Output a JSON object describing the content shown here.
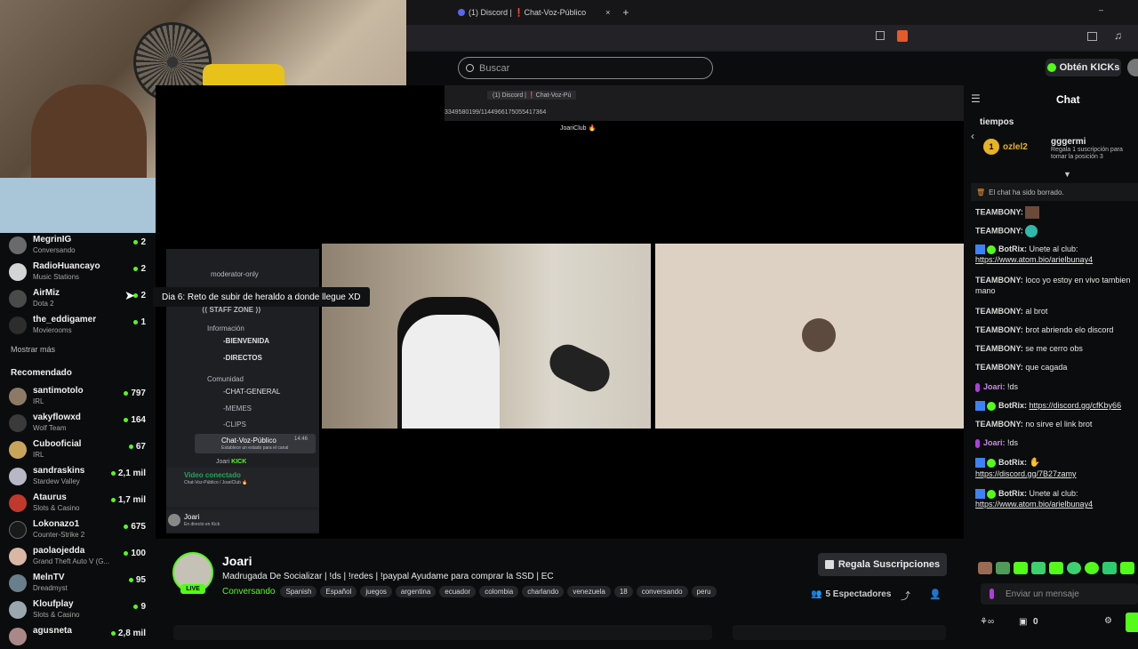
{
  "browser": {
    "tab_title": "(1) Discord | ❗Chat-Voz-Público",
    "new_tab": "+",
    "inner_tab_title": "(1) Discord | ❗Chat-Voz-Pú",
    "inner_url": "3349580199/1144966175055417364",
    "inner_bookmark": "JoariClub 🔥"
  },
  "kick": {
    "search_placeholder": "Buscar",
    "obtain_label": "Obtén KICKs"
  },
  "sidebar": {
    "following": [
      {
        "name": "MegrinIG",
        "sub": "Conversando",
        "count": "2"
      },
      {
        "name": "RadioHuancayo",
        "sub": "Music Stations",
        "count": "2"
      },
      {
        "name": "AirMiz",
        "sub": "Dota 2",
        "count": "2"
      },
      {
        "name": "the_eddigamer",
        "sub": "Movierooms",
        "count": "1"
      }
    ],
    "show_more": "Mostrar más",
    "recommended_title": "Recomendado",
    "recommended": [
      {
        "name": "santimotolo",
        "sub": "IRL",
        "count": "797"
      },
      {
        "name": "vakyflowxd",
        "sub": "Wolf Team",
        "count": "164"
      },
      {
        "name": "Cubooficial",
        "sub": "IRL",
        "count": "67"
      },
      {
        "name": "sandraskins",
        "sub": "Stardew Valley",
        "count": "2,1 mil"
      },
      {
        "name": "Ataurus",
        "sub": "Slots & Casino",
        "count": "1,7 mil"
      },
      {
        "name": "Lokonazo1",
        "sub": "Counter-Strike 2",
        "count": "675"
      },
      {
        "name": "paolaojedda",
        "sub": "Grand Theft Auto V (G...",
        "count": "100"
      },
      {
        "name": "MelnTV",
        "sub": "Dreadmyst",
        "count": "95"
      },
      {
        "name": "Kloufplay",
        "sub": "Slots & Casino",
        "count": "9"
      },
      {
        "name": "agusneta",
        "sub": "",
        "count": "2,8 mil"
      }
    ]
  },
  "discord": {
    "channel_top": "moderator-only",
    "staff_zone": "⟨⟨ STAFF ZONE ⟩⟩",
    "info_section": "Información",
    "ch_bienvenida": "-BIENVENIDA",
    "ch_directos": "-DIRECTOS",
    "comunidad_section": "Comunidad",
    "ch_general": "-CHAT-GENERAL",
    "ch_memes": "-MEMES",
    "ch_clips": "-CLIPS",
    "ch_voice": "Chat-Voz-Público",
    "ch_voice_time": "14:46",
    "ch_voice_sub": "Establece un estado para el canal",
    "voice_user": "Joari",
    "voice_user_badge": "KICK",
    "video_connected": "Video conectado",
    "video_connected_sub": "Chat-Voz-Público / JoariClub 🔥",
    "user_name": "Joari",
    "user_status": "En directo en Kick"
  },
  "tooltip": "Dia 6: Reto de subir de heraldo a donde llegue XD",
  "stream": {
    "channel": "Joari",
    "title": "Madrugada De Socializar | !ds | !redes | !paypal  Ayudame para comprar la SSD | EC",
    "category": "Conversando",
    "live_label": "LIVE",
    "tags": [
      "Spanish",
      "Español",
      "juegos",
      "argentina",
      "ecuador",
      "colombia",
      "charlando",
      "venezuela",
      "18",
      "conversando",
      "peru"
    ],
    "gift_label": "Regala Suscripciones",
    "viewers": "5 Espectadores"
  },
  "chat": {
    "header": "Chat",
    "pinned_title": "tiempos",
    "leader1_name": "ozlel2",
    "leader1_rank": "1",
    "leader2_name": "gggermi",
    "leader2_desc": "Regala 1 suscripción para tomar la posición 3",
    "cleared": "El chat ha sido borrado.",
    "input_placeholder": "Enviar un mensaje",
    "points": "0",
    "messages": [
      {
        "user": "TEAMBONY:",
        "text": ""
      },
      {
        "user": "TEAMBONY:",
        "text": ""
      },
      {
        "user": "BotRix:",
        "text": "Unete al club:",
        "link": "https://www.atom.bio/arielbunay4"
      },
      {
        "user": "TEAMBONY:",
        "text": "loco yo estoy en vivo tambien mano"
      },
      {
        "user": "TEAMBONY:",
        "text": "al brot"
      },
      {
        "user": "TEAMBONY:",
        "text": "brot abriendo elo discord"
      },
      {
        "user": "TEAMBONY:",
        "text": "se me cerro obs"
      },
      {
        "user": "TEAMBONY:",
        "text": "que cagada"
      },
      {
        "user": "Joari:",
        "text": "!ds"
      },
      {
        "user": "BotRix:",
        "text": "",
        "link": "https://discord.gg/cfKby66"
      },
      {
        "user": "TEAMBONY:",
        "text": "no sirve el link brot"
      },
      {
        "user": "Joari:",
        "text": "!ds"
      },
      {
        "user": "BotRix:",
        "text": "",
        "link": "https://discord.gg/7B27zamy"
      },
      {
        "user": "BotRix:",
        "text": "Unete al club:",
        "link": "https://www.atom.bio/arielbunay4"
      }
    ]
  }
}
